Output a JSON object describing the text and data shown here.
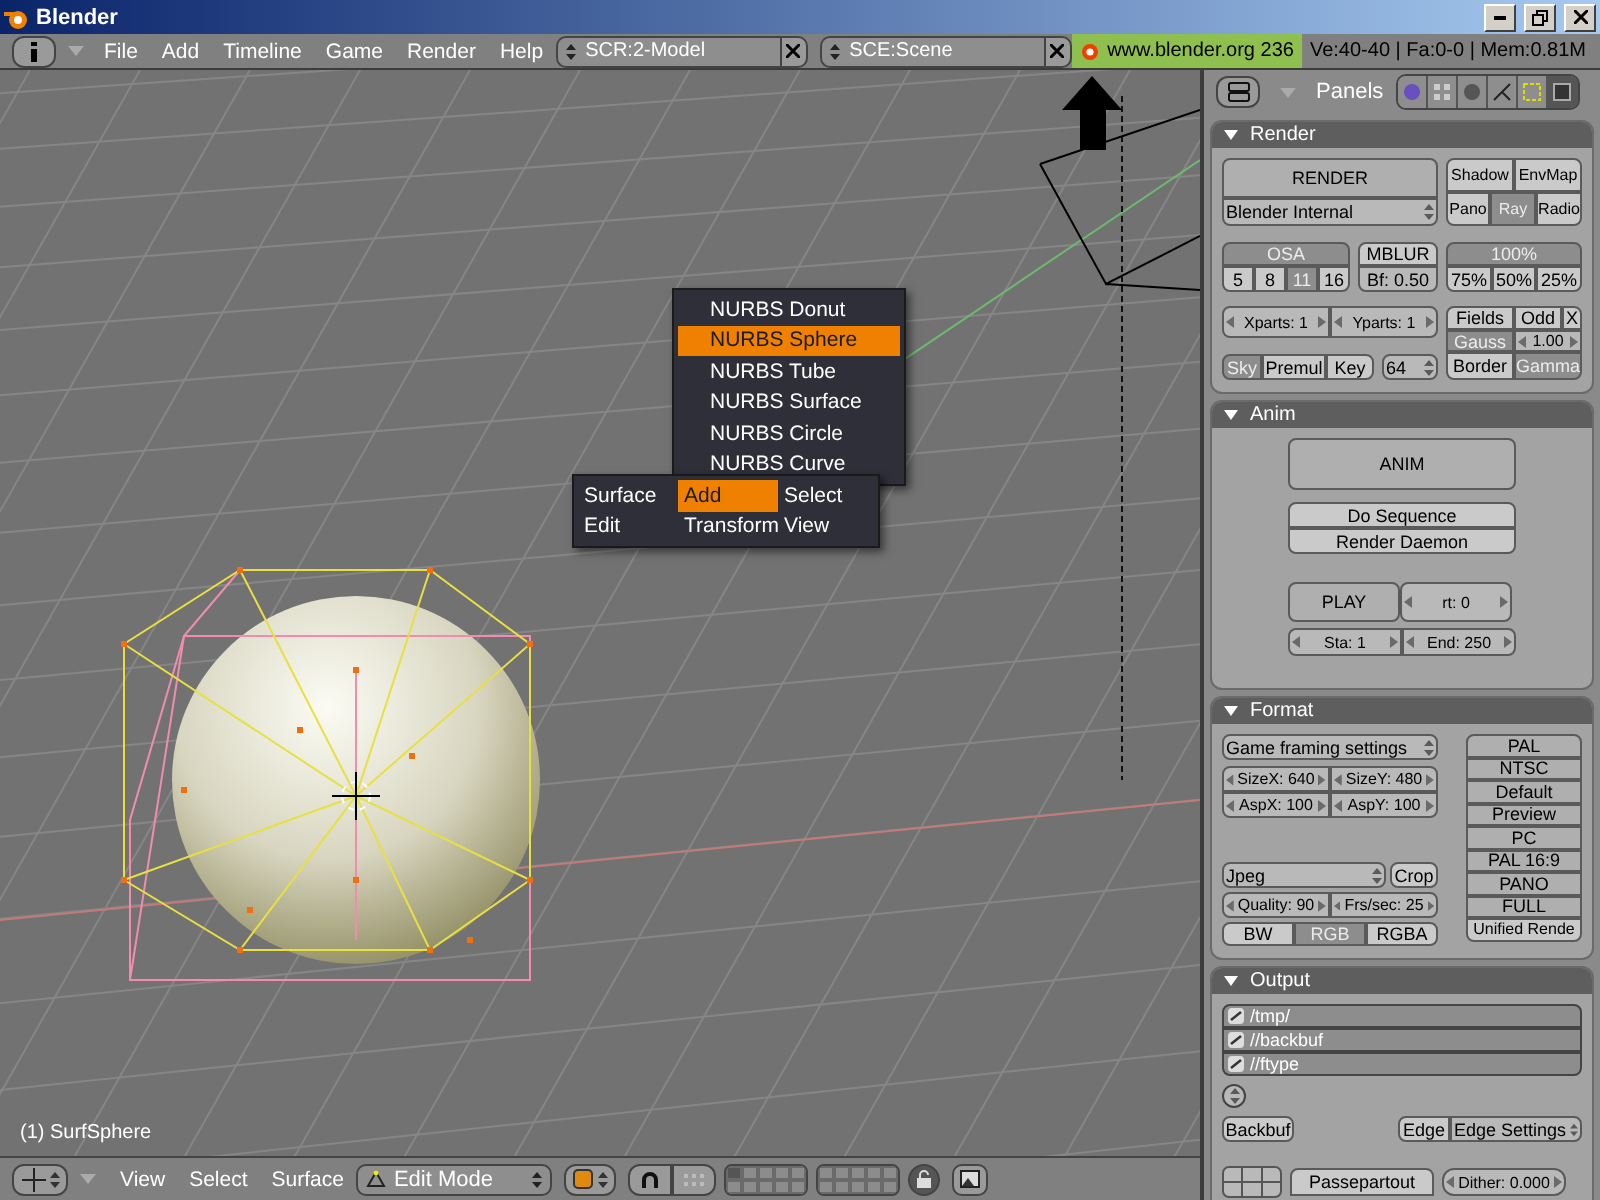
{
  "window": {
    "title": "Blender"
  },
  "header": {
    "menus": [
      "File",
      "Add",
      "Timeline",
      "Game",
      "Render",
      "Help"
    ],
    "screen": "SCR:2-Model",
    "scene": "SCE:Scene",
    "link": "www.blender.org 236",
    "stats": "Ve:40-40 | Fa:0-0 | Mem:0.81M"
  },
  "viewport": {
    "object_name": "(1) SurfSphere"
  },
  "add_menu": [
    {
      "label": "NURBS Donut",
      "selected": false
    },
    {
      "label": "NURBS Sphere",
      "selected": true
    },
    {
      "label": "NURBS Tube",
      "selected": false
    },
    {
      "label": "NURBS Surface",
      "selected": false
    },
    {
      "label": "NURBS Circle",
      "selected": false
    },
    {
      "label": "NURBS Curve",
      "selected": false
    }
  ],
  "toolbox": [
    {
      "label": "Surface",
      "selected": false
    },
    {
      "label": "Add",
      "selected": true
    },
    {
      "label": "Select",
      "selected": false
    },
    {
      "label": "Edit",
      "selected": false
    },
    {
      "label": "Transform",
      "selected": false
    },
    {
      "label": "View",
      "selected": false
    }
  ],
  "viewport_header": {
    "menus": [
      "View",
      "Select",
      "Surface"
    ],
    "mode": "Edit Mode"
  },
  "buttons_window": {
    "title": "Panels",
    "context_tabs": [
      {
        "selected": false
      },
      {
        "selected": false
      },
      {
        "selected": false
      },
      {
        "selected": false
      },
      {
        "selected": false
      },
      {
        "selected": true
      }
    ]
  },
  "render": {
    "title": "Render",
    "render_button": "RENDER",
    "renderer": "Blender Internal",
    "toggles": [
      {
        "label": "Shadow",
        "on": false
      },
      {
        "label": "EnvMap",
        "on": false
      },
      {
        "label": "Pano",
        "on": false
      },
      {
        "label": "Ray",
        "on": true
      },
      {
        "label": "Radio",
        "on": false
      }
    ],
    "osa": {
      "label": "OSA",
      "on": true
    },
    "osa_levels": [
      {
        "label": "5",
        "selected": false
      },
      {
        "label": "8",
        "selected": false
      },
      {
        "label": "11",
        "selected": true
      },
      {
        "label": "16",
        "selected": false
      }
    ],
    "mblur": {
      "label": "MBLUR",
      "on": false
    },
    "blur_factor": "Bf: 0.50",
    "scale": {
      "label": "100%",
      "on": true
    },
    "scale_options": [
      {
        "label": "75%",
        "selected": false
      },
      {
        "label": "50%",
        "selected": false
      },
      {
        "label": "25%",
        "selected": false
      }
    ],
    "xparts": "Xparts: 1",
    "yparts": "Yparts: 1",
    "field_toggles": [
      {
        "label": "Fields",
        "on": false
      },
      {
        "label": "Odd",
        "on": false
      },
      {
        "label": "X",
        "on": false
      }
    ],
    "gauss": {
      "label": "Gauss",
      "on": true
    },
    "filter": "1.00",
    "alpha_modes": [
      {
        "label": "Sky",
        "selected": true
      },
      {
        "label": "Premul",
        "selected": false
      },
      {
        "label": "Key",
        "selected": false
      }
    ],
    "depth": "64",
    "border": {
      "label": "Border",
      "on": false
    },
    "gamma": {
      "label": "Gamma",
      "on": true
    }
  },
  "anim": {
    "title": "Anim",
    "anim_button": "ANIM",
    "toggles": [
      {
        "label": "Do Sequence",
        "on": false
      },
      {
        "label": "Render Daemon",
        "on": false
      }
    ],
    "play_button": "PLAY",
    "rate": "rt: 0",
    "start": "Sta: 1",
    "end": "End: 250"
  },
  "format": {
    "title": "Format",
    "preset_menu": "Game framing settings",
    "fields": [
      "SizeX: 640",
      "SizeY: 480",
      "AspX: 100",
      "AspY: 100"
    ],
    "presets": [
      "PAL",
      "NTSC",
      "Default",
      "Preview",
      "PC",
      "PAL 16:9",
      "PANO",
      "FULL"
    ],
    "unified": {
      "label": "Unified Rende",
      "on": false
    },
    "file_type": "Jpeg",
    "crop": {
      "label": "Crop",
      "on": false
    },
    "quality": "Quality: 90",
    "fps": "Frs/sec: 25",
    "color_modes": [
      {
        "label": "BW",
        "selected": false
      },
      {
        "label": "RGB",
        "selected": true
      },
      {
        "label": "RGBA",
        "selected": false
      }
    ]
  },
  "output": {
    "title": "Output",
    "paths": [
      "/tmp/",
      "//backbuf",
      "//ftype"
    ],
    "backbuf": {
      "label": "Backbuf",
      "on": false
    },
    "edge": {
      "label": "Edge",
      "on": false
    },
    "edge_settings": "Edge Settings",
    "passepartout": {
      "label": "Passepartout",
      "on": false
    },
    "dither": "Dither: 0.000"
  }
}
